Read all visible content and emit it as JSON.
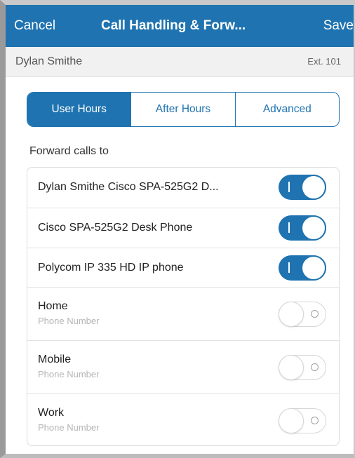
{
  "navbar": {
    "cancel_label": "Cancel",
    "title": "Call Handling & Forw...",
    "save_label": "Save"
  },
  "user": {
    "name": "Dylan Smithe",
    "extension": "Ext. 101"
  },
  "tabs": [
    {
      "label": "User Hours",
      "active": true
    },
    {
      "label": "After Hours",
      "active": false
    },
    {
      "label": "Advanced",
      "active": false
    }
  ],
  "forward_section_label": "Forward calls to",
  "forward_targets": [
    {
      "label": "Dylan Smithe Cisco SPA-525G2 D...",
      "enabled": true
    },
    {
      "label": "Cisco SPA-525G2 Desk Phone",
      "enabled": true
    },
    {
      "label": "Polycom IP 335 HD IP phone",
      "enabled": true
    },
    {
      "label": "Home",
      "sublabel": "Phone Number",
      "enabled": false
    },
    {
      "label": "Mobile",
      "sublabel": "Phone Number",
      "enabled": false
    },
    {
      "label": "Work",
      "sublabel": "Phone Number",
      "enabled": false
    }
  ],
  "colors": {
    "accent": "#1f73b0",
    "toggle_off_border": "#d6d6d6",
    "sublabel": "#b5b5b5"
  },
  "icons": {
    "toggle_on_mark": "toggle-on-bar-icon",
    "toggle_off_mark": "toggle-off-circle-icon"
  }
}
